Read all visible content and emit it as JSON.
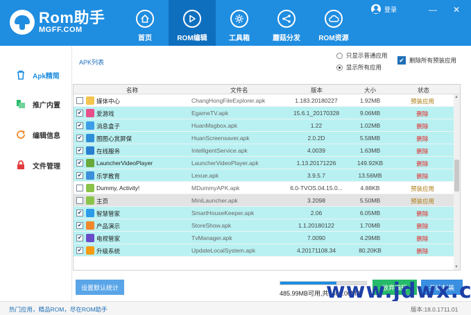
{
  "logo": {
    "title": "Rom助手",
    "subtitle": "MGFF.COM"
  },
  "nav": [
    {
      "label": "首页",
      "icon": "home-icon"
    },
    {
      "label": "ROM编辑",
      "icon": "play-icon"
    },
    {
      "label": "工具箱",
      "icon": "gear-icon"
    },
    {
      "label": "蘑菇分发",
      "icon": "share-icon"
    },
    {
      "label": "ROM资源",
      "icon": "cloud-icon"
    }
  ],
  "header": {
    "login_label": "登录",
    "minimize": "—",
    "close": "✕"
  },
  "sidebar": [
    {
      "label": "Apk精简",
      "icon": "trash-icon",
      "active": true
    },
    {
      "label": "推广内置",
      "icon": "push-icon",
      "active": false
    },
    {
      "label": "编辑信息",
      "icon": "refresh-icon",
      "active": false
    },
    {
      "label": "文件管理",
      "icon": "lock-icon",
      "active": false
    }
  ],
  "main": {
    "title": "APK列表",
    "radio_normal": "只显示普通应用",
    "radio_all": "显示所有应用",
    "delete_preinstall": "删除所有预装应用"
  },
  "table": {
    "headers": {
      "name": "名称",
      "file": "文件名",
      "version": "版本",
      "size": "大小",
      "status": "状态"
    },
    "rows": [
      {
        "name": "媒体中心",
        "file": "ChangHongFileExplorer.apk",
        "version": "1.183.20180227",
        "size": "1.92MB",
        "status": "预装应用",
        "checked": false,
        "color": "#f3c550"
      },
      {
        "name": "爱游戏",
        "file": "EgameTV.apk",
        "version": "15.6.1_20170328",
        "size": "9.06MB",
        "status": "删除",
        "checked": true,
        "color": "#e84e8a"
      },
      {
        "name": "消息盒子",
        "file": "HuanMsgbox.apk",
        "version": "1.22",
        "size": "1.02MB",
        "status": "删除",
        "checked": true,
        "color": "#3d9ee8"
      },
      {
        "name": "图图心赏屏保",
        "file": "HuanScreensaver.apk",
        "version": "2.0.2D",
        "size": "5.58MB",
        "status": "删除",
        "checked": true,
        "color": "#2f8ed8"
      },
      {
        "name": "在线服务",
        "file": "IntelligentService.apk",
        "version": "4.0039",
        "size": "1.63MB",
        "status": "删除",
        "checked": true,
        "color": "#2a7fd0"
      },
      {
        "name": "LauncherVideoPlayer",
        "file": "LauncherVideoPlayer.apk",
        "version": "1.13.20171226",
        "size": "149.92KB",
        "status": "删除",
        "checked": true,
        "color": "#6aaa3c"
      },
      {
        "name": "乐学教育",
        "file": "Lexue.apk",
        "version": "3.9.5.7",
        "size": "13.56MB",
        "status": "删除",
        "checked": true,
        "color": "#3b90db"
      },
      {
        "name": "Dummy, Activity!",
        "file": "MDummyAPK.apk",
        "version": "6.0-TVOS.04.15.0...",
        "size": "4.88KB",
        "status": "预装应用",
        "checked": false,
        "color": "#8bc34a"
      },
      {
        "name": "主页",
        "file": "MiniLauncher.apk",
        "version": "3.2098",
        "size": "5.50MB",
        "status": "预装应用",
        "checked": false,
        "color": "#8bc34a"
      },
      {
        "name": "智慧管家",
        "file": "SmartHouseKeeper.apk",
        "version": "2.06",
        "size": "6.05MB",
        "status": "删除",
        "checked": true,
        "color": "#2c9be8"
      },
      {
        "name": "产品演示",
        "file": "StoreShow.apk",
        "version": "1.1.20180122",
        "size": "1.70MB",
        "status": "删除",
        "checked": true,
        "color": "#f0892b"
      },
      {
        "name": "电视管家",
        "file": "TvManager.apk",
        "version": "7.0090",
        "size": "4.29MB",
        "status": "删除",
        "checked": true,
        "color": "#6a4cc8"
      },
      {
        "name": "升级系统",
        "file": "UpdateLocalSystem.apk",
        "version": "4.20171108.34",
        "size": "80.20KB",
        "status": "删除",
        "checked": true,
        "color": "#f39c12"
      }
    ]
  },
  "bottom": {
    "stats_button": "设置默认统计",
    "storage_text": "485.99MB可用,共1400.00MB",
    "storage_fraction": 0.65,
    "green_button": "放弃编辑",
    "blue_button": "开始封装"
  },
  "footer": {
    "left": "热门应用，精品ROM，尽在ROM助手",
    "right": "版本:18.0.1711.01"
  },
  "watermark": "www.jdwx.cn"
}
